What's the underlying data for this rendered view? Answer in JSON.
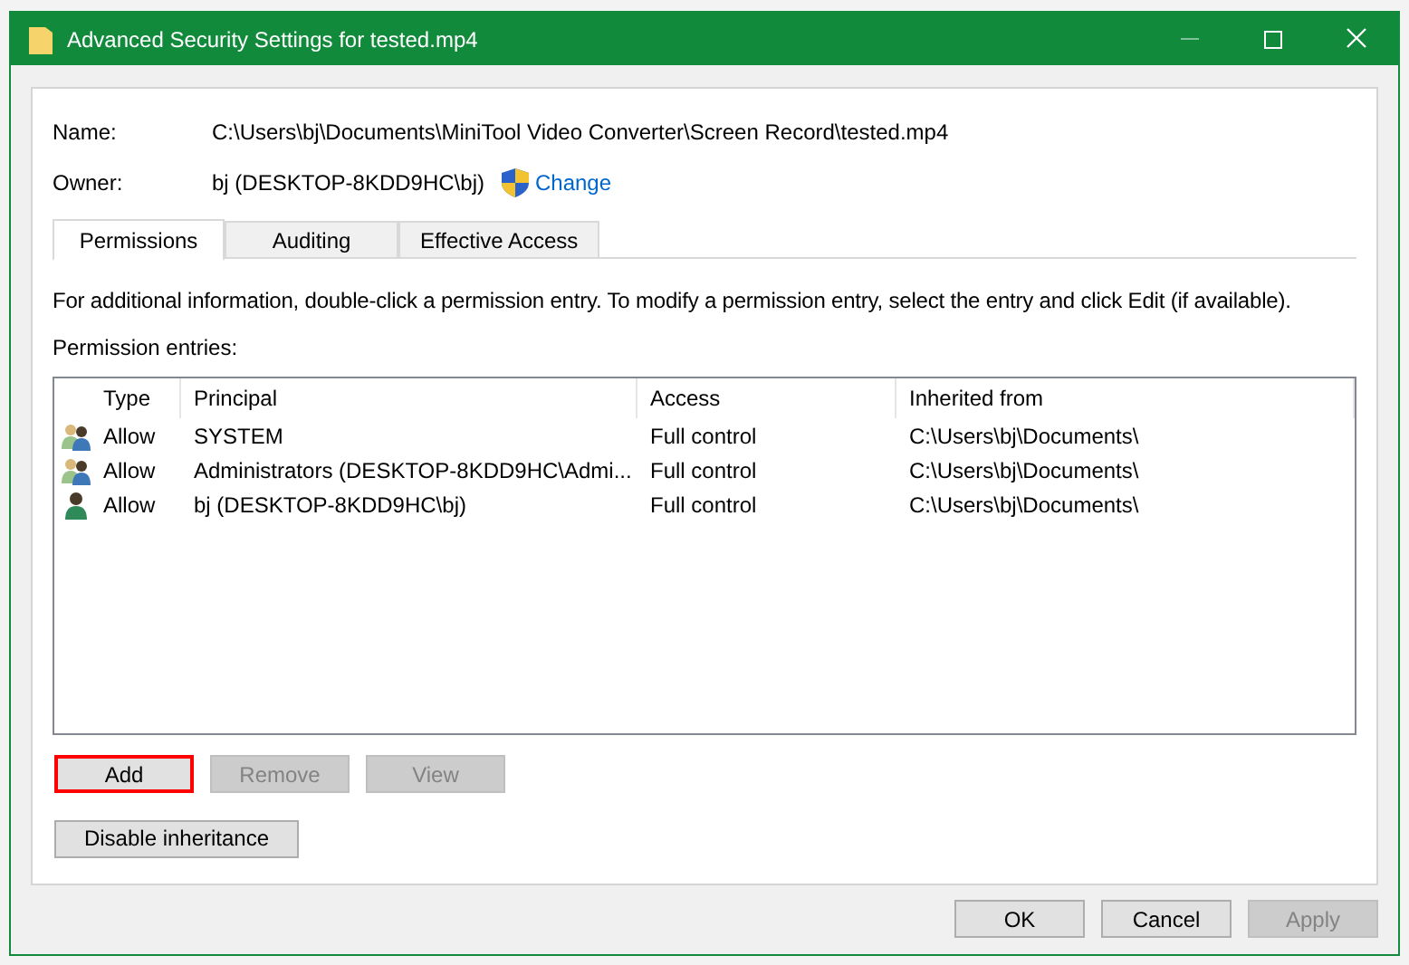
{
  "window": {
    "title": "Advanced Security Settings for tested.mp4"
  },
  "fields": [
    {
      "label": "Name:",
      "value": "C:\\Users\\bj\\Documents\\MiniTool Video Converter\\Screen Record\\tested.mp4"
    },
    {
      "label": "Owner:",
      "value": "bj (DESKTOP-8KDD9HC\\bj)",
      "link": "Change"
    }
  ],
  "tabs": [
    {
      "label": "Permissions",
      "selected": true
    },
    {
      "label": "Auditing",
      "selected": false
    },
    {
      "label": "Effective Access",
      "selected": false
    }
  ],
  "description": "For additional information, double-click a permission entry. To modify a permission entry, select the entry and click Edit (if available).",
  "entries_label": "Permission entries:",
  "table": {
    "columns": [
      "Type",
      "Principal",
      "Access",
      "Inherited from"
    ],
    "rows": [
      {
        "kind": "group",
        "cells": [
          "Allow",
          "SYSTEM",
          "Full control",
          "C:\\Users\\bj\\Documents\\"
        ]
      },
      {
        "kind": "group",
        "cells": [
          "Allow",
          "Administrators (DESKTOP-8KDD9HC\\Admi...",
          "Full control",
          "C:\\Users\\bj\\Documents\\"
        ]
      },
      {
        "kind": "user",
        "cells": [
          "Allow",
          "bj (DESKTOP-8KDD9HC\\bj)",
          "Full control",
          "C:\\Users\\bj\\Documents\\"
        ]
      }
    ]
  },
  "entry_buttons": [
    {
      "label": "Add",
      "disabled": false,
      "highlighted": true
    },
    {
      "label": "Remove",
      "disabled": true,
      "highlighted": false
    },
    {
      "label": "View",
      "disabled": true,
      "highlighted": false
    }
  ],
  "inheritance_button": {
    "label": "Disable inheritance"
  },
  "dialog_buttons": [
    {
      "label": "OK",
      "disabled": false
    },
    {
      "label": "Cancel",
      "disabled": false
    },
    {
      "label": "Apply",
      "disabled": true
    }
  ]
}
